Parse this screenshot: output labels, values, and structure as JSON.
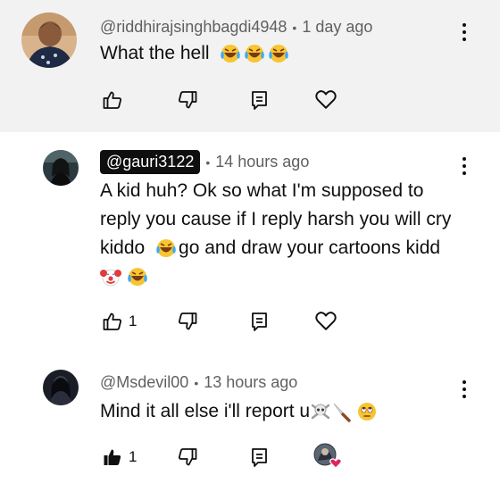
{
  "comments": [
    {
      "author": "@riddhirajsinghbagdi4948",
      "time": "1 day ago",
      "text": "What the hell",
      "like_count": ""
    },
    {
      "author": "@gauri3122",
      "time": "14 hours ago",
      "line1": "A kid huh? Ok so what I'm supposed to",
      "line2": "reply you cause if I reply harsh you will cry",
      "line3a": "kiddo",
      "line3b": "go and draw your cartoons kidd",
      "like_count": "1"
    },
    {
      "author": "@Msdevil00",
      "time": "13 hours ago",
      "text": "Mind it all else i'll report u",
      "like_count": "1"
    }
  ],
  "separator": "•",
  "icons": [
    "like-icon",
    "dislike-icon",
    "reply-icon",
    "heart-icon",
    "more-vert-icon",
    "creator-heart-badge"
  ],
  "colors": {
    "highlight_bg": "#f2f2f2",
    "meta_text": "#606060",
    "heart_red": "#e0245e"
  }
}
